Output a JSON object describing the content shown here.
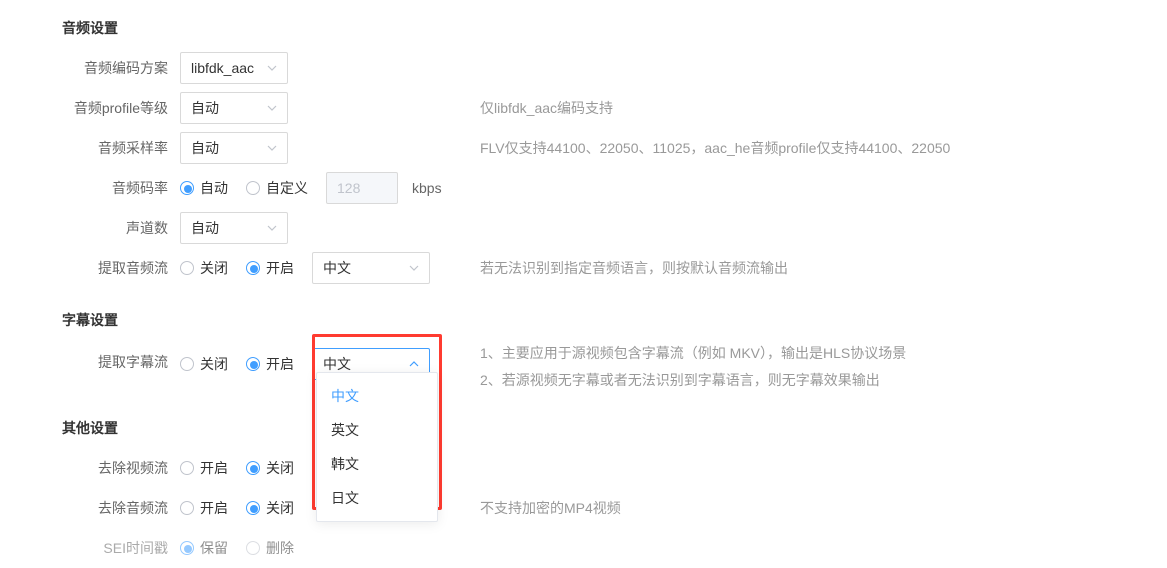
{
  "sections": {
    "audio_title": "音频设置",
    "subtitle_title": "字幕设置",
    "other_title": "其他设置"
  },
  "audio": {
    "codec_label": "音频编码方案",
    "codec_value": "libfdk_aac",
    "profile_label": "音频profile等级",
    "profile_value": "自动",
    "profile_hint": "仅libfdk_aac编码支持",
    "samplerate_label": "音频采样率",
    "samplerate_value": "自动",
    "samplerate_hint": "FLV仅支持44100、22050、11025，aac_he音频profile仅支持44100、22050",
    "bitrate_label": "音频码率",
    "bitrate_auto": "自动",
    "bitrate_custom": "自定义",
    "bitrate_placeholder": "128",
    "bitrate_unit": "kbps",
    "channels_label": "声道数",
    "channels_value": "自动",
    "extract_label": "提取音频流",
    "extract_off": "关闭",
    "extract_on": "开启",
    "extract_lang_value": "中文",
    "extract_hint": "若无法识别到指定音频语言，则按默认音频流输出"
  },
  "subtitle": {
    "extract_label": "提取字幕流",
    "extract_off": "关闭",
    "extract_on": "开启",
    "lang_value": "中文",
    "hint1": "1、主要应用于源视频包含字幕流（例如 MKV），输出是HLS协议场景",
    "hint2": "2、若源视频无字幕或者无法识别到字幕语言，则无字幕效果输出",
    "options": [
      "中文",
      "英文",
      "韩文",
      "日文"
    ]
  },
  "other": {
    "remove_video_label": "去除视频流",
    "remove_audio_label": "去除音频流",
    "on": "开启",
    "off": "关闭",
    "remove_audio_hint": "不支持加密的MP4视频",
    "sei_label": "SEI时间戳",
    "sei_keep": "保留",
    "sei_remove": "删除"
  }
}
